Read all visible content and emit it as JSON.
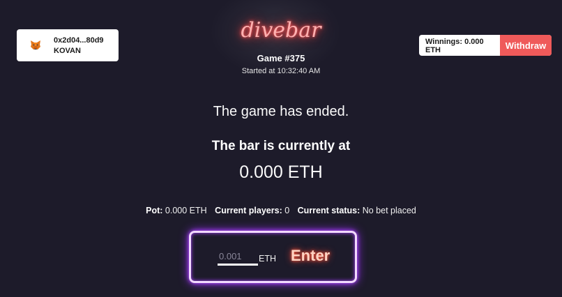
{
  "wallet": {
    "address": "0x2d04...80d9",
    "network": "KOVAN",
    "icon": "metamask-fox-icon"
  },
  "logo": "divebar",
  "game": {
    "title": "Game #375",
    "started": "Started at 10:32:40 AM"
  },
  "winnings": {
    "label": "Winnings: 0.000 ETH",
    "withdraw_label": "Withdraw"
  },
  "status_message": "The game has ended.",
  "bar": {
    "label": "The bar is currently at",
    "value": "0.000 ETH"
  },
  "stats": {
    "pot_label": "Pot:",
    "pot_value": "0.000 ETH",
    "players_label": "Current players:",
    "players_value": "0",
    "status_label": "Current status:",
    "status_value": "No bet placed"
  },
  "entry": {
    "placeholder": "0.001",
    "unit": "ETH",
    "enter_label": "Enter"
  },
  "colors": {
    "background": "#1d1b2a",
    "accent_red": "#ef5a5a",
    "neon_purple": "#9b30ff"
  }
}
